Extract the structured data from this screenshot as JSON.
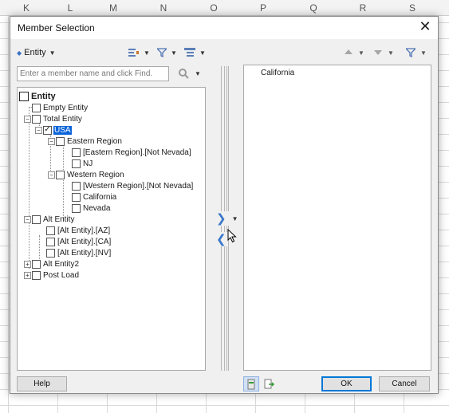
{
  "spreadsheet": {
    "columns": [
      "K",
      "L",
      "M",
      "N",
      "O",
      "P",
      "Q",
      "R",
      "S"
    ]
  },
  "dialog": {
    "title": "Member Selection",
    "close_glyph": "✕"
  },
  "left_toolbar": {
    "dimension_label": "Entity",
    "icons": [
      "member-list-icon",
      "filter-icon",
      "layout-icon"
    ]
  },
  "search": {
    "placeholder": "Enter a member name and click Find.",
    "value": ""
  },
  "tree": [
    {
      "label": "Entity",
      "level": 0,
      "expander": "",
      "checked": false,
      "selected": false,
      "bold": true
    },
    {
      "label": "Empty Entity",
      "level": 1,
      "expander": "",
      "checked": false,
      "selected": false,
      "bold": false
    },
    {
      "label": "Total Entity",
      "level": 1,
      "expander": "−",
      "checked": false,
      "selected": false,
      "bold": false
    },
    {
      "label": "USA",
      "level": 2,
      "expander": "−",
      "checked": true,
      "selected": true,
      "bold": false
    },
    {
      "label": "Eastern Region",
      "level": 3,
      "expander": "−",
      "checked": false,
      "selected": false,
      "bold": false
    },
    {
      "label": "[Eastern Region].[Not Nevada]",
      "level": 4,
      "expander": "",
      "checked": false,
      "selected": false,
      "bold": false
    },
    {
      "label": "NJ",
      "level": 4,
      "expander": "",
      "checked": false,
      "selected": false,
      "bold": false
    },
    {
      "label": "Western Region",
      "level": 3,
      "expander": "−",
      "checked": false,
      "selected": false,
      "bold": false
    },
    {
      "label": "[Western Region].[Not Nevada]",
      "level": 4,
      "expander": "",
      "checked": false,
      "selected": false,
      "bold": false
    },
    {
      "label": "California",
      "level": 4,
      "expander": "",
      "checked": false,
      "selected": false,
      "bold": false
    },
    {
      "label": "Nevada",
      "level": 4,
      "expander": "",
      "checked": false,
      "selected": false,
      "bold": false
    },
    {
      "label": "Alt Entity",
      "level": 1,
      "expander": "−",
      "checked": false,
      "selected": false,
      "bold": false
    },
    {
      "label": "[Alt Entity].[AZ]",
      "level": 2,
      "expander": "",
      "checked": false,
      "selected": false,
      "bold": false
    },
    {
      "label": "[Alt Entity].[CA]",
      "level": 2,
      "expander": "",
      "checked": false,
      "selected": false,
      "bold": false
    },
    {
      "label": "[Alt Entity].[NV]",
      "level": 2,
      "expander": "",
      "checked": false,
      "selected": false,
      "bold": false
    },
    {
      "label": "Alt Entity2",
      "level": 1,
      "expander": "+",
      "checked": false,
      "selected": false,
      "bold": false
    },
    {
      "label": "Post Load",
      "level": 1,
      "expander": "+",
      "checked": false,
      "selected": false,
      "bold": false
    }
  ],
  "move_controls": {
    "add_glyph": "❯",
    "remove_glyph": "❮"
  },
  "selections": [
    "California"
  ],
  "right_toolbar": {
    "icons": [
      "move-up-icon",
      "move-down-icon",
      "filter-icon"
    ]
  },
  "buttons": {
    "help": "Help",
    "ok": "OK",
    "cancel": "Cancel"
  },
  "colors": {
    "selection_highlight": "#0a64d8",
    "arrow_blue": "#3a78c9",
    "default_button_border": "#0078d7"
  }
}
